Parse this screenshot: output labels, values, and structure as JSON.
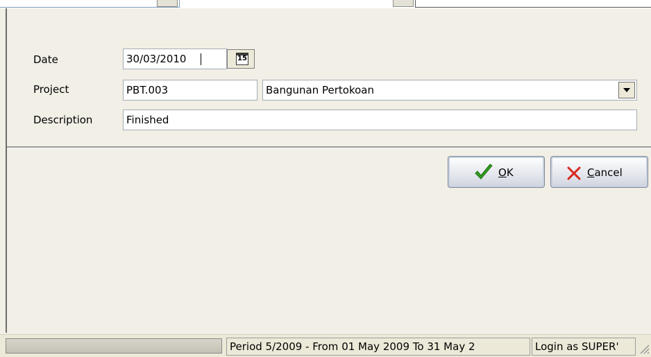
{
  "form": {
    "date_label": "Date",
    "date_value": "30/03/2010",
    "calendar_icon_text": "15",
    "project_label": "Project",
    "project_code": "PBT.003",
    "project_name": "Bangunan Pertokoan",
    "description_label": "Description",
    "description_value": "Finished"
  },
  "buttons": {
    "ok_label": "OK",
    "cancel_label": "Cancel"
  },
  "status_bar": {
    "progress": 0,
    "period_text": "Period 5/2009 - From 01 May 2009 To 31 May 2",
    "login_text": "Login as SUPER'"
  },
  "icons": {
    "calendar": "calendar-icon",
    "dropdown": "chevron-down-icon",
    "ok": "check-icon",
    "cancel": "close-icon",
    "grip": "resize-grip-icon"
  },
  "colors": {
    "window_bg": "#f1efe6",
    "check_green": "#2f9e1e",
    "cancel_red": "#d8281e",
    "field_border": "#a5acb5"
  }
}
